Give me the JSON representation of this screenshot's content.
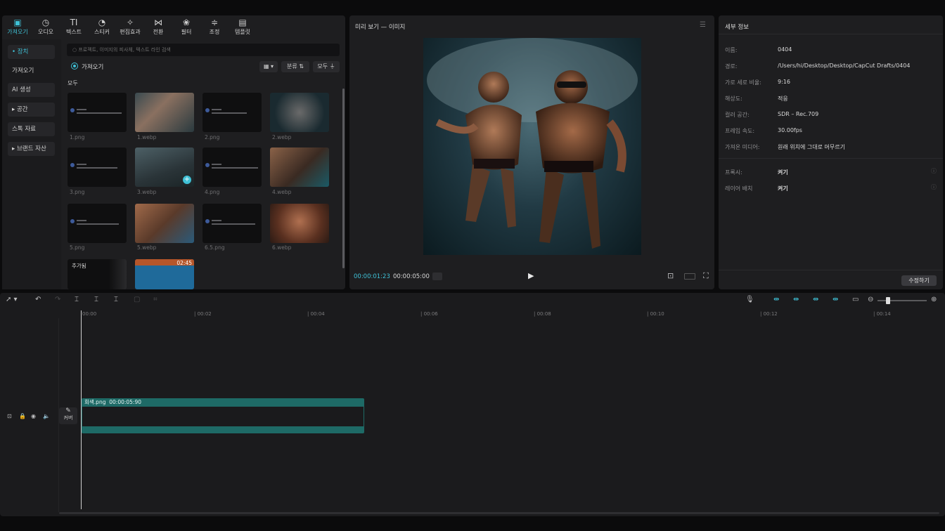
{
  "toolbar": {
    "items": [
      {
        "label": "가져오기",
        "icon": "import-icon",
        "glyph": "▣"
      },
      {
        "label": "오디오",
        "icon": "audio-icon",
        "glyph": "◷"
      },
      {
        "label": "텍스트",
        "icon": "text-icon",
        "glyph": "TI"
      },
      {
        "label": "스티커",
        "icon": "sticker-icon",
        "glyph": "◔"
      },
      {
        "label": "편집효과",
        "icon": "effects-icon",
        "glyph": "✧"
      },
      {
        "label": "전환",
        "icon": "transition-icon",
        "glyph": "⋈"
      },
      {
        "label": "필터",
        "icon": "filter-icon",
        "glyph": "❀"
      },
      {
        "label": "조정",
        "icon": "adjust-icon",
        "glyph": "≑"
      },
      {
        "label": "템플릿",
        "icon": "template-icon",
        "glyph": "▤"
      }
    ]
  },
  "sidebar": {
    "items": [
      "• 장치",
      "가져오기",
      "AI 생성",
      "▸ 공간",
      "스톡 자료",
      "▸ 브랜드 자산"
    ]
  },
  "media": {
    "search_placeholder": "○ 프로젝트, 이미지의 피사체, 텍스트 라인 검색",
    "import_label": "가져오기",
    "sort_label": "분류",
    "filter_label": "모두",
    "section_label": "모두",
    "thumbs": [
      {
        "label": "1.png"
      },
      {
        "label": "1.webp"
      },
      {
        "label": "2.png"
      },
      {
        "label": "2.webp"
      },
      {
        "label": "3.png"
      },
      {
        "label": "3.webp"
      },
      {
        "label": "4.png"
      },
      {
        "label": "4.webp"
      },
      {
        "label": "5.png"
      },
      {
        "label": "5.webp"
      },
      {
        "label": "6.5.png"
      },
      {
        "label": "6.webp"
      }
    ],
    "extra_label": "추가됨",
    "video_duration": "02:45"
  },
  "preview": {
    "title": "미리 보기 — 이미지",
    "current_time": "00:00:01:23",
    "total_time": "00:00:05:00"
  },
  "details": {
    "title": "세부 정보",
    "rows": [
      {
        "key": "이름:",
        "value": "0404"
      },
      {
        "key": "경로:",
        "value": "/Users/hi/Desktop/Desktop/CapCut Drafts/0404"
      },
      {
        "key": "가로 세로 비율:",
        "value": "9:16"
      },
      {
        "key": "해상도:",
        "value": "적응"
      },
      {
        "key": "컬러 공간:",
        "value": "SDR – Rec.709"
      },
      {
        "key": "프레임 속도:",
        "value": "30.00fps"
      },
      {
        "key": "가져온 미디어:",
        "value": "원래 위치에 그대로 머무르기"
      }
    ],
    "toggles": [
      {
        "key": "프록시:",
        "value": "켜기"
      },
      {
        "key": "레이어 배치",
        "value": "켜기"
      }
    ],
    "edit_label": "수정하기"
  },
  "timeline": {
    "ticks": [
      "00:00",
      "| 00:02",
      "| 00:04",
      "| 00:06",
      "| 00:08",
      "| 00:10",
      "| 00:12",
      "| 00:14"
    ],
    "clip_name": "회색.png",
    "clip_duration": "00:00:05:90",
    "cover_label": "커버"
  }
}
